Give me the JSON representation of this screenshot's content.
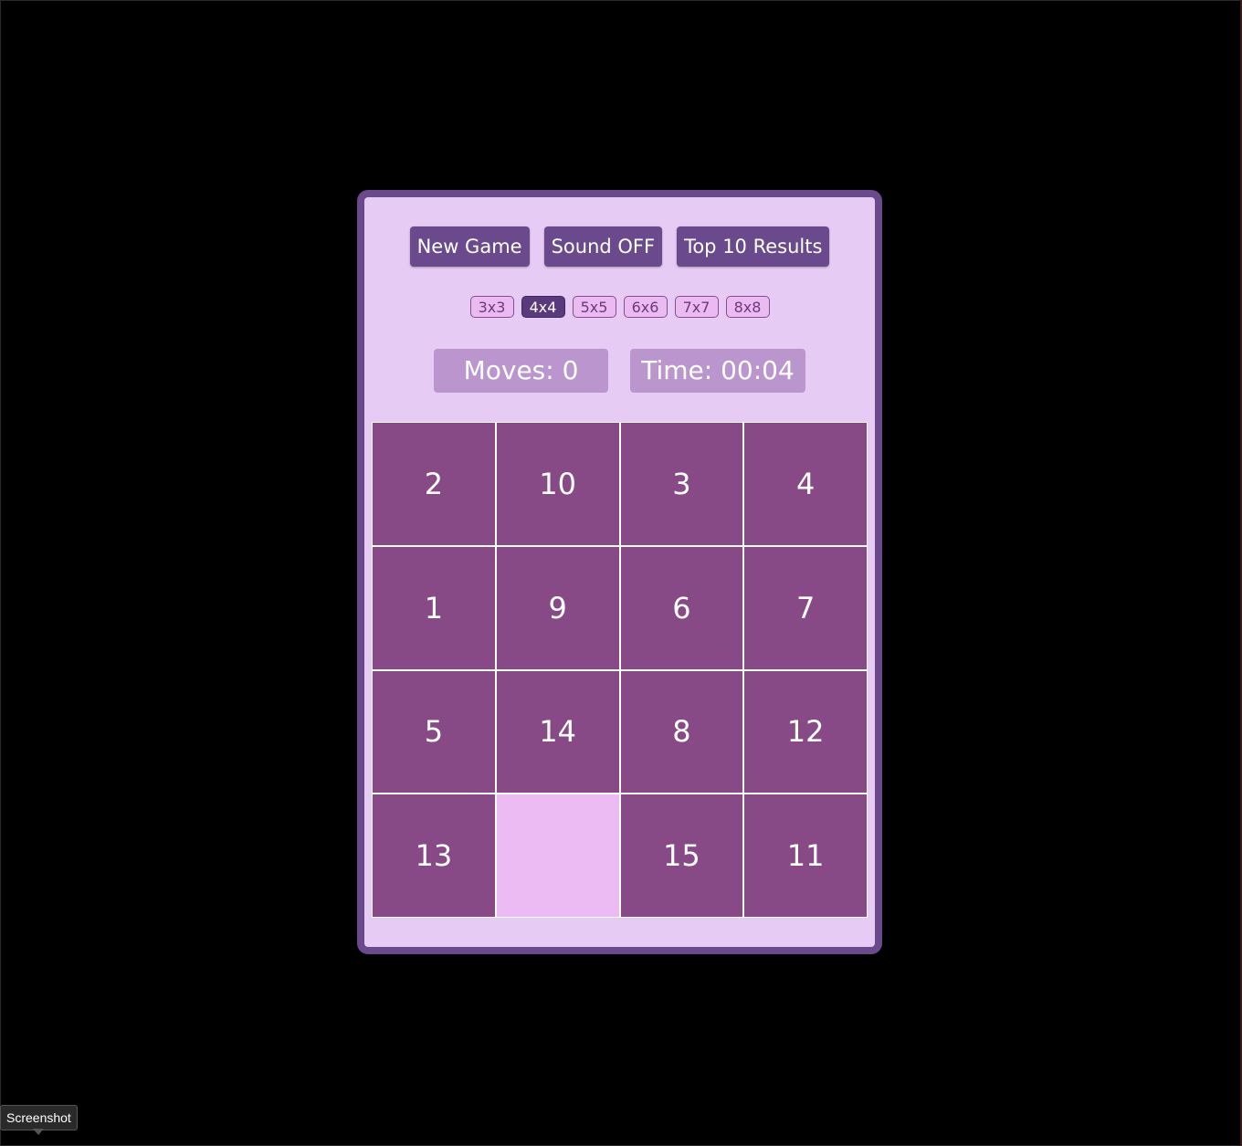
{
  "controls": {
    "new_game": "New Game",
    "sound": "Sound OFF",
    "top10": "Top 10 Results"
  },
  "sizes": {
    "options": [
      "3x3",
      "4x4",
      "5x5",
      "6x6",
      "7x7",
      "8x8"
    ],
    "selected": "4x4"
  },
  "stats": {
    "moves": "Moves: 0",
    "time": "Time: 00:04"
  },
  "board": {
    "size": 4,
    "tiles": [
      "2",
      "10",
      "3",
      "4",
      "1",
      "9",
      "6",
      "7",
      "5",
      "14",
      "8",
      "12",
      "13",
      "",
      "15",
      "11"
    ]
  },
  "tooltip": {
    "label": "Screenshot"
  },
  "colors": {
    "page_background": "#000000",
    "panel_background": "#e6ccf5",
    "panel_border": "#6a4a8c",
    "tile": "#874a86",
    "empty_tile": "#ecbbf3",
    "stat_box": "#bb95ce"
  }
}
